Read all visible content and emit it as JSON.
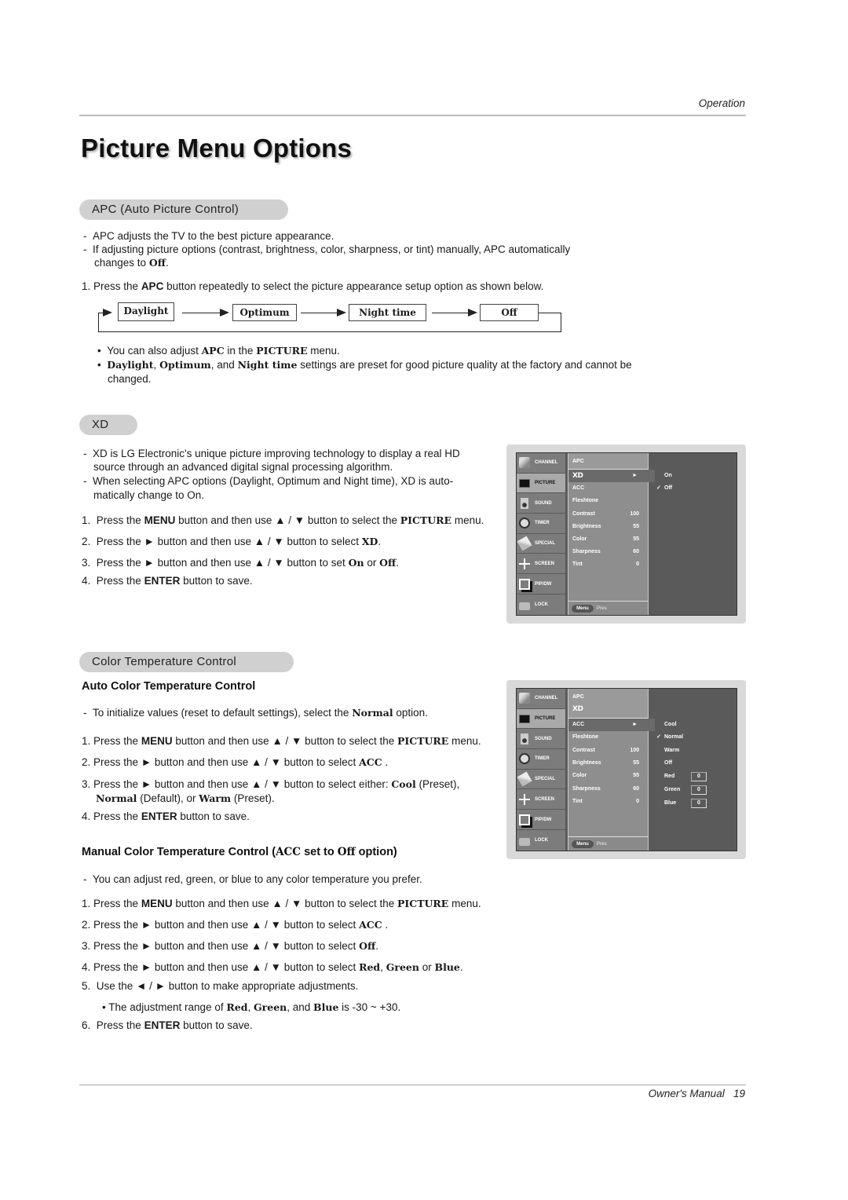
{
  "header": {
    "section": "Operation"
  },
  "page_title": "Picture Menu Options",
  "apc": {
    "pill": "APC (Auto Picture Control)",
    "notes": [
      "APC adjusts the TV to the best picture appearance.",
      "If adjusting picture options (contrast, brightness, color, sharpness, or tint) manually, APC automatically",
      "changes to"
    ],
    "off_word": "Off",
    "step1_pre": "1. Press the",
    "step1_key": "APC",
    "step1_post": "button repeatedly to select the picture appearance setup option as shown below.",
    "flow": [
      "Daylight",
      "Optimum",
      "Night time",
      "Off"
    ],
    "bullet1": {
      "pre": "You can also adjust",
      "k1": "APC",
      "mid": "in the",
      "k2": "PICTURE",
      "post": "menu."
    },
    "bullet2": {
      "k1": "Daylight",
      "s1": ",",
      "k2": "Optimum",
      "s2": ", and",
      "k3": "Night time",
      "post": "settings are preset for good picture quality at the factory and cannot be",
      "cont": "changed."
    }
  },
  "xd": {
    "pill": "XD",
    "notes": [
      "XD is LG Electronic's unique picture improving technology to display a real HD",
      "source through an advanced digital signal processing algorithm.",
      "When selecting APC options (Daylight, Optimum and Night time), XD is auto-",
      "matically change to On."
    ],
    "steps": [
      {
        "n": "1.",
        "pre": "Press the",
        "k1": "MENU",
        "mid": "button and then use ▲ / ▼  button to select the",
        "k2": "PICTURE",
        "post": "menu."
      },
      {
        "n": "2.",
        "pre": "Press the ►  button and then use ▲ / ▼ button to select",
        "k1": "XD",
        "post": "."
      },
      {
        "n": "3.",
        "pre": "Press the ►  button and then use ▲ / ▼ button to set",
        "k1": "On",
        "mid": "or",
        "k2": "Off",
        "post": "."
      },
      {
        "n": "4.",
        "pre": "Press the",
        "k1": "ENTER",
        "post": "button to save."
      }
    ]
  },
  "color_temp": {
    "pill": "Color Temperature Control",
    "auto_heading": "Auto Color Temperature Control",
    "auto_note": {
      "pre": "To initialize values (reset to default settings), select the",
      "k": "Normal",
      "post": "option."
    },
    "auto_steps": [
      {
        "n": "1.",
        "pre": "Press the",
        "k1": "MENU",
        "mid": "button and then use ▲ / ▼  button to select the",
        "k2": "PICTURE",
        "post": "menu."
      },
      {
        "n": "2.",
        "pre": "Press the ►  button and then use ▲ / ▼ button to select",
        "k1": "ACC",
        "post": "."
      },
      {
        "n": "3.",
        "pre": "Press the ►  button and then use ▲ / ▼ button to select either:",
        "k1": "Cool",
        "post": "(Preset),",
        "cont_k1": "Normal",
        "cont_mid": "(Default), or",
        "cont_k2": "Warm",
        "cont_post": "(Preset)."
      },
      {
        "n": "4.",
        "pre": "Press the",
        "k1": "ENTER",
        "post": "button to save."
      }
    ],
    "manual_heading": {
      "pre": "Manual Color Temperature Control (",
      "k1": "ACC",
      "mid": "set to",
      "k2": "Off",
      "post": "option)"
    },
    "manual_note": "You can adjust red, green, or blue to any color temperature you prefer.",
    "manual_steps": [
      {
        "n": "1.",
        "pre": "Press the",
        "k1": "MENU",
        "mid": "button and then use ▲ / ▼  button to select the",
        "k2": "PICTURE",
        "post": "menu."
      },
      {
        "n": "2.",
        "pre": "Press the ►  button and then use ▲ / ▼ button to select",
        "k1": "ACC",
        "post": "."
      },
      {
        "n": "3.",
        "pre": "Press the ►  button and then use ▲ / ▼ button to select",
        "k1": "Off",
        "post": "."
      },
      {
        "n": "4.",
        "pre": "Press the ►  button and then use ▲ / ▼ button to select",
        "k1": "Red",
        "s1": ",",
        "k2": "Green",
        "mid": "or",
        "k3": "Blue",
        "post": "."
      },
      {
        "n": "5.",
        "text": "Use the ◄ / ► button to make appropriate adjustments."
      },
      {
        "n": "•",
        "pre": "The adjustment range of",
        "k1": "Red",
        "s1": ",",
        "k2": "Green",
        "mid": ", and",
        "k3": "Blue",
        "post": "is -30 ~ +30."
      },
      {
        "n": "6.",
        "pre": "Press the",
        "k1": "ENTER",
        "post": "button to save."
      }
    ]
  },
  "osd": {
    "sidebar": [
      "CHANNEL",
      "PICTURE",
      "SOUND",
      "TIMER",
      "SPECIAL",
      "SCREEN",
      "PIP/DW",
      "LOCK"
    ],
    "selected_sidebar": "PICTURE",
    "items": [
      {
        "label": "APC",
        "value": ""
      },
      {
        "label": "XD",
        "value": ""
      },
      {
        "label": "ACC",
        "value": ""
      },
      {
        "label": "Fleshtone",
        "value": ""
      },
      {
        "label": "Contrast",
        "value": "100"
      },
      {
        "label": "Brightness",
        "value": "55"
      },
      {
        "label": "Color",
        "value": "55"
      },
      {
        "label": "Sharpness",
        "value": "60"
      },
      {
        "label": "Tint",
        "value": "0"
      }
    ],
    "footer": {
      "menu": "Menu",
      "prev": "Prev."
    },
    "arrow": "►",
    "check": "✓",
    "screen1": {
      "highlight": "XD",
      "options": [
        "On",
        "Off"
      ],
      "checked": "Off"
    },
    "screen2": {
      "highlight": "ACC",
      "options": [
        "Cool",
        "Normal",
        "Warm",
        "Off"
      ],
      "checked": "Normal",
      "rgb": [
        {
          "label": "Red",
          "value": "0"
        },
        {
          "label": "Green",
          "value": "0"
        },
        {
          "label": "Blue",
          "value": "0"
        }
      ]
    }
  },
  "footer": {
    "label": "Owner's Manual",
    "page": "19"
  }
}
